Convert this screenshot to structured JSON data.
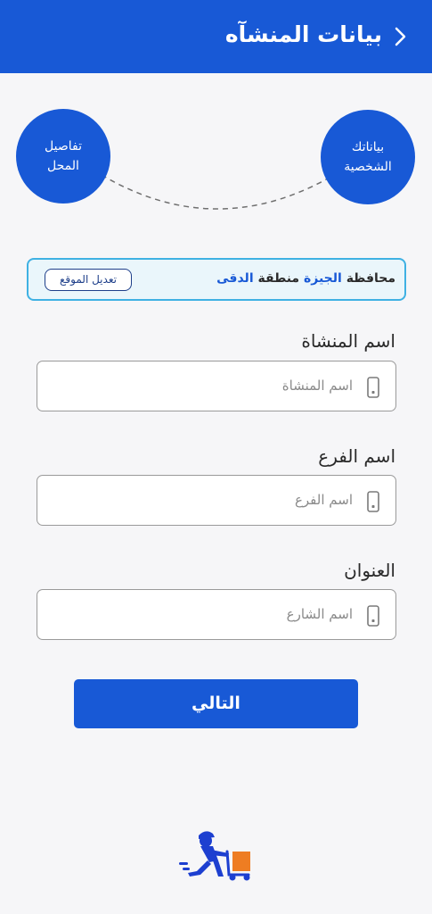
{
  "header": {
    "title": "بيانات المنشآه",
    "back_icon": "chevron-right-icon",
    "background_color": "#1859d6"
  },
  "steps": [
    {
      "label": "بياناتك\nالشخصية"
    },
    {
      "label": "تفاصيل\nالمحل"
    }
  ],
  "location": {
    "governorate_label": "محافظة",
    "governorate_value": "الجيزة",
    "area_label": "منطقة",
    "area_value": "الدقى",
    "edit_button": "تعديل الموقع",
    "border_color": "#3fb1e3"
  },
  "fields": [
    {
      "label": "اسم المنشاة",
      "placeholder": "اسم المنشاة",
      "value": ""
    },
    {
      "label": "اسم الفرع",
      "placeholder": "اسم الفرع",
      "value": ""
    },
    {
      "label": "العنوان",
      "placeholder": "اسم الشارع",
      "value": ""
    }
  ],
  "next_button": "التالي",
  "logo_icon": "delivery-person-icon"
}
